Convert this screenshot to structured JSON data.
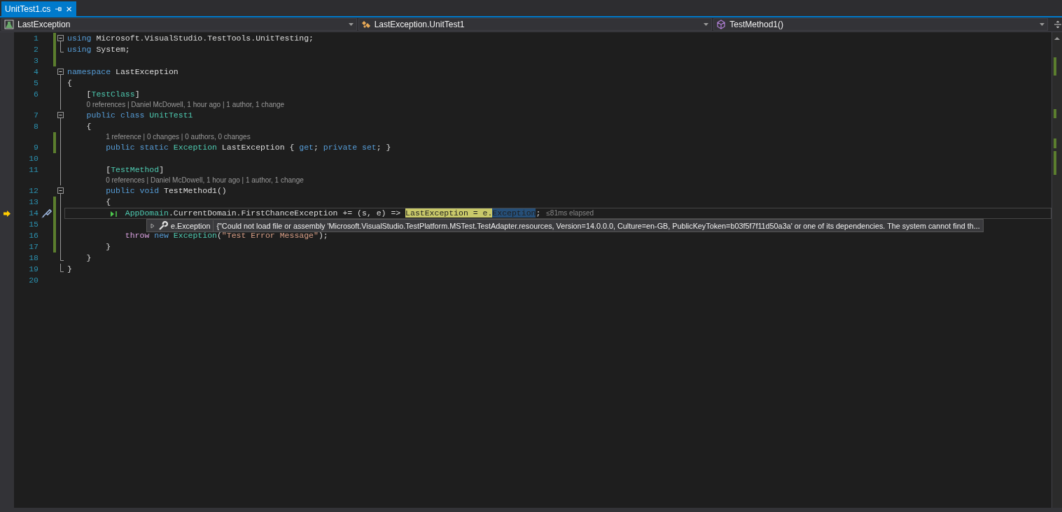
{
  "tab": {
    "title": "UnitTest1.cs",
    "close": "×",
    "selected": true
  },
  "nav": [
    {
      "kind": "project",
      "label": "LastException"
    },
    {
      "kind": "class",
      "label": "LastException.UnitTest1"
    },
    {
      "kind": "method",
      "label": "TestMethod1()"
    }
  ],
  "editor": {
    "lines": [
      {
        "number": "1",
        "changed": true,
        "kind": "fold-start",
        "tokens": [
          {
            "t": "using",
            "kind": "kw"
          },
          {
            "t": " Microsoft.VisualStudio.TestTools.UnitTesting;",
            "kind": "p"
          }
        ]
      },
      {
        "number": "2",
        "changed": true,
        "kind": "fold-end",
        "tokens": [
          {
            "t": "using",
            "kind": "kw"
          },
          {
            "t": " System;",
            "kind": "p"
          }
        ]
      },
      {
        "number": "3",
        "changed": true,
        "kind": "plain"
      },
      {
        "number": "4",
        "changed": false,
        "kind": "fold-start",
        "tokens": [
          {
            "t": "namespace",
            "kind": "kw"
          },
          {
            "t": " LastException",
            "kind": "p"
          }
        ]
      },
      {
        "number": "5",
        "changed": false,
        "kind": "fold-mid",
        "tokens": [
          {
            "t": "{",
            "kind": "p"
          }
        ]
      },
      {
        "number": "6",
        "changed": false,
        "kind": "fold-mid",
        "tokens": [
          {
            "t": "    [",
            "kind": "p"
          },
          {
            "t": "TestClass",
            "kind": "type"
          },
          {
            "t": "]",
            "kind": "p"
          }
        ]
      },
      {
        "number": "7",
        "changed": false,
        "kind": "fold-start",
        "lens": "0 references | Daniel McDowell, 1 hour ago | 1 author, 1 change",
        "tokens": [
          {
            "t": "    public class",
            "kind": "kw"
          },
          {
            "t": " UnitTest1",
            "kind": "type"
          }
        ]
      },
      {
        "number": "8",
        "changed": false,
        "kind": "fold-mid",
        "tokens": [
          {
            "t": "    {",
            "kind": "p"
          }
        ]
      },
      {
        "number": "9",
        "changed": true,
        "kind": "fold-mid",
        "lens": "1 reference | 0 changes | 0 authors, 0 changes",
        "tokens": [
          {
            "t": "        public static",
            "kind": "kw"
          },
          {
            "t": " Exception",
            "kind": "type"
          },
          {
            "t": " LastException { ",
            "kind": "p"
          },
          {
            "t": "get",
            "kind": "kw"
          },
          {
            "t": "; ",
            "kind": "p"
          },
          {
            "t": "private set",
            "kind": "kw"
          },
          {
            "t": "; }",
            "kind": "p"
          }
        ]
      },
      {
        "number": "10",
        "changed": false,
        "kind": "fold-mid"
      },
      {
        "number": "11",
        "changed": false,
        "kind": "fold-mid",
        "tokens": [
          {
            "t": "        [",
            "kind": "p"
          },
          {
            "t": "TestMethod",
            "kind": "type"
          },
          {
            "t": "]",
            "kind": "p"
          }
        ]
      },
      {
        "number": "12",
        "changed": false,
        "kind": "fold-start",
        "lens": "0 references | Daniel McDowell, 1 hour ago | 1 author, 1 change",
        "tokens": [
          {
            "t": "        public void",
            "kind": "kw"
          },
          {
            "t": " TestMethod1()",
            "kind": "p"
          }
        ]
      },
      {
        "number": "13",
        "changed": true,
        "kind": "fold-mid",
        "tokens": [
          {
            "t": "        {",
            "kind": "p"
          }
        ]
      },
      {
        "number": "14",
        "changed": true,
        "kind": "fold-mid",
        "current": true,
        "elapsed": "≤81ms elapsed",
        "tokens": [
          {
            "t": "            AppDomain",
            "kind": "type"
          },
          {
            "t": ".CurrentDomain.FirstChanceException += (s, e) => ",
            "kind": "p"
          },
          {
            "t": "LastException = e.",
            "kind": "hl"
          },
          {
            "t": "Exception",
            "kind": "sel"
          },
          {
            "t": ";",
            "kind": "p"
          }
        ],
        "datatip": {
          "name": "e.Exception",
          "value": "{\"Could not load file or assembly 'Microsoft.VisualStudio.TestPlatform.MSTest.TestAdapter.resources, Version=14.0.0.0, Culture=en-GB, PublicKeyToken=b03f5f7f11d50a3a' or one of its dependencies. The system cannot find th..."
        }
      },
      {
        "number": "15",
        "changed": true,
        "kind": "fold-mid"
      },
      {
        "number": "16",
        "changed": true,
        "kind": "fold-mid",
        "tokens": [
          {
            "t": "            throw",
            "kind": "ctl"
          },
          {
            "t": " new",
            "kind": "kw"
          },
          {
            "t": " Exception",
            "kind": "type"
          },
          {
            "t": "(",
            "kind": "p"
          },
          {
            "t": "\"Test Error Message\"",
            "kind": "str"
          },
          {
            "t": ");",
            "kind": "p"
          }
        ]
      },
      {
        "number": "17",
        "changed": true,
        "kind": "fold-mid",
        "tokens": [
          {
            "t": "        }",
            "kind": "p"
          }
        ]
      },
      {
        "number": "18",
        "changed": false,
        "kind": "fold-end",
        "tokens": [
          {
            "t": "    }",
            "kind": "p"
          }
        ]
      },
      {
        "number": "19",
        "changed": false,
        "kind": "fold-end",
        "tokens": [
          {
            "t": "}",
            "kind": "p"
          }
        ]
      },
      {
        "number": "20",
        "changed": false,
        "kind": "plain"
      }
    ]
  }
}
